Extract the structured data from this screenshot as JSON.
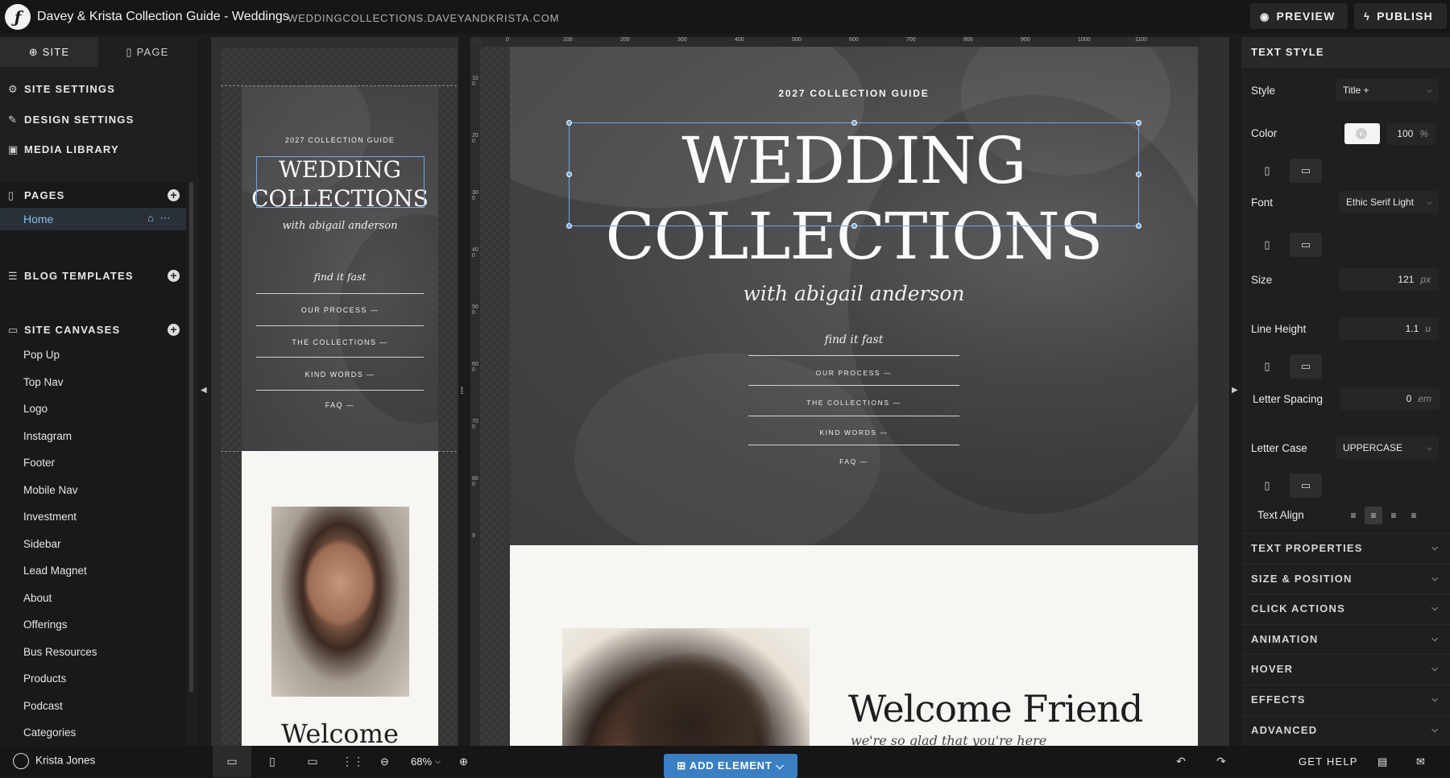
{
  "app": {
    "title": "Davey & Krista Collection Guide - Weddings",
    "url": "WEDDINGCOLLECTIONS.DAVEYANDKRISTA.COM",
    "preview_label": "PREVIEW",
    "publish_label": "PUBLISH"
  },
  "left_sidebar": {
    "tabs": [
      "SITE",
      "PAGE"
    ],
    "menu": [
      "SITE SETTINGS",
      "DESIGN SETTINGS",
      "MEDIA LIBRARY"
    ],
    "pages_heading": "PAGES",
    "home_label": "Home",
    "blog_templates_heading": "BLOG TEMPLATES",
    "site_canvases_heading": "SITE CANVASES",
    "canvases": [
      "Pop Up",
      "Top Nav",
      "Logo",
      "Instagram",
      "Footer",
      "Mobile Nav",
      "Investment",
      "Sidebar",
      "Lead Magnet",
      "About",
      "Offerings",
      "Bus Resources",
      "Products",
      "Podcast",
      "Categories"
    ]
  },
  "mobile_preview": {
    "kicker": "2027 COLLECTION GUIDE",
    "title_line1": "WEDDING",
    "title_line2": "COLLECTIONS",
    "subtitle": "with abigail anderson",
    "find": "find it fast",
    "nav": [
      "OUR PROCESS —",
      "THE COLLECTIONS —",
      "KIND WORDS —",
      "FAQ —"
    ],
    "welcome": "Welcome"
  },
  "main_canvas": {
    "ruler_top": [
      "0",
      "100",
      "200",
      "300",
      "400",
      "500",
      "600",
      "700",
      "800",
      "900",
      "1000",
      "1100"
    ],
    "ruler_left": [
      "100",
      "200",
      "300",
      "400",
      "500",
      "600",
      "700",
      "800",
      "9"
    ],
    "kicker": "2027 COLLECTION GUIDE",
    "title_line1": "WEDDING",
    "title_line2": "COLLECTIONS",
    "subtitle": "with abigail anderson",
    "find": "find it fast",
    "nav": [
      "OUR PROCESS —",
      "THE COLLECTIONS —",
      "KIND WORDS —",
      "FAQ —"
    ],
    "welcome": "Welcome Friend",
    "welcome_sub": "we're so glad that you're here"
  },
  "right_panel": {
    "heading": "TEXT STYLE",
    "style_label": "Style",
    "style_value": "Title +",
    "color_label": "Color",
    "color_opacity": "100",
    "color_unit": "%",
    "font_label": "Font",
    "font_value": "Ethic Serif Light",
    "size_label": "Size",
    "size_value": "121",
    "size_unit": "px",
    "line_height_label": "Line Height",
    "line_height_value": "1.1",
    "line_height_unit": "u",
    "letter_spacing_label": "Letter Spacing",
    "letter_spacing_value": "0",
    "letter_spacing_unit": "em",
    "letter_case_label": "Letter Case",
    "letter_case_value": "UPPERCASE",
    "text_align_label": "Text Align",
    "text_align_selected": "center",
    "sections": [
      "TEXT PROPERTIES",
      "SIZE & POSITION",
      "CLICK ACTIONS",
      "ANIMATION",
      "HOVER",
      "EFFECTS",
      "ADVANCED"
    ]
  },
  "bottom_bar": {
    "user_name": "Krista Jones",
    "zoom": "68%",
    "add_element": "ADD ELEMENT",
    "get_help": "GET HELP"
  },
  "colors": {
    "accent": "#6ea8dc",
    "add_button": "#3a7fc4",
    "app_bg": "#1b1b1c"
  }
}
